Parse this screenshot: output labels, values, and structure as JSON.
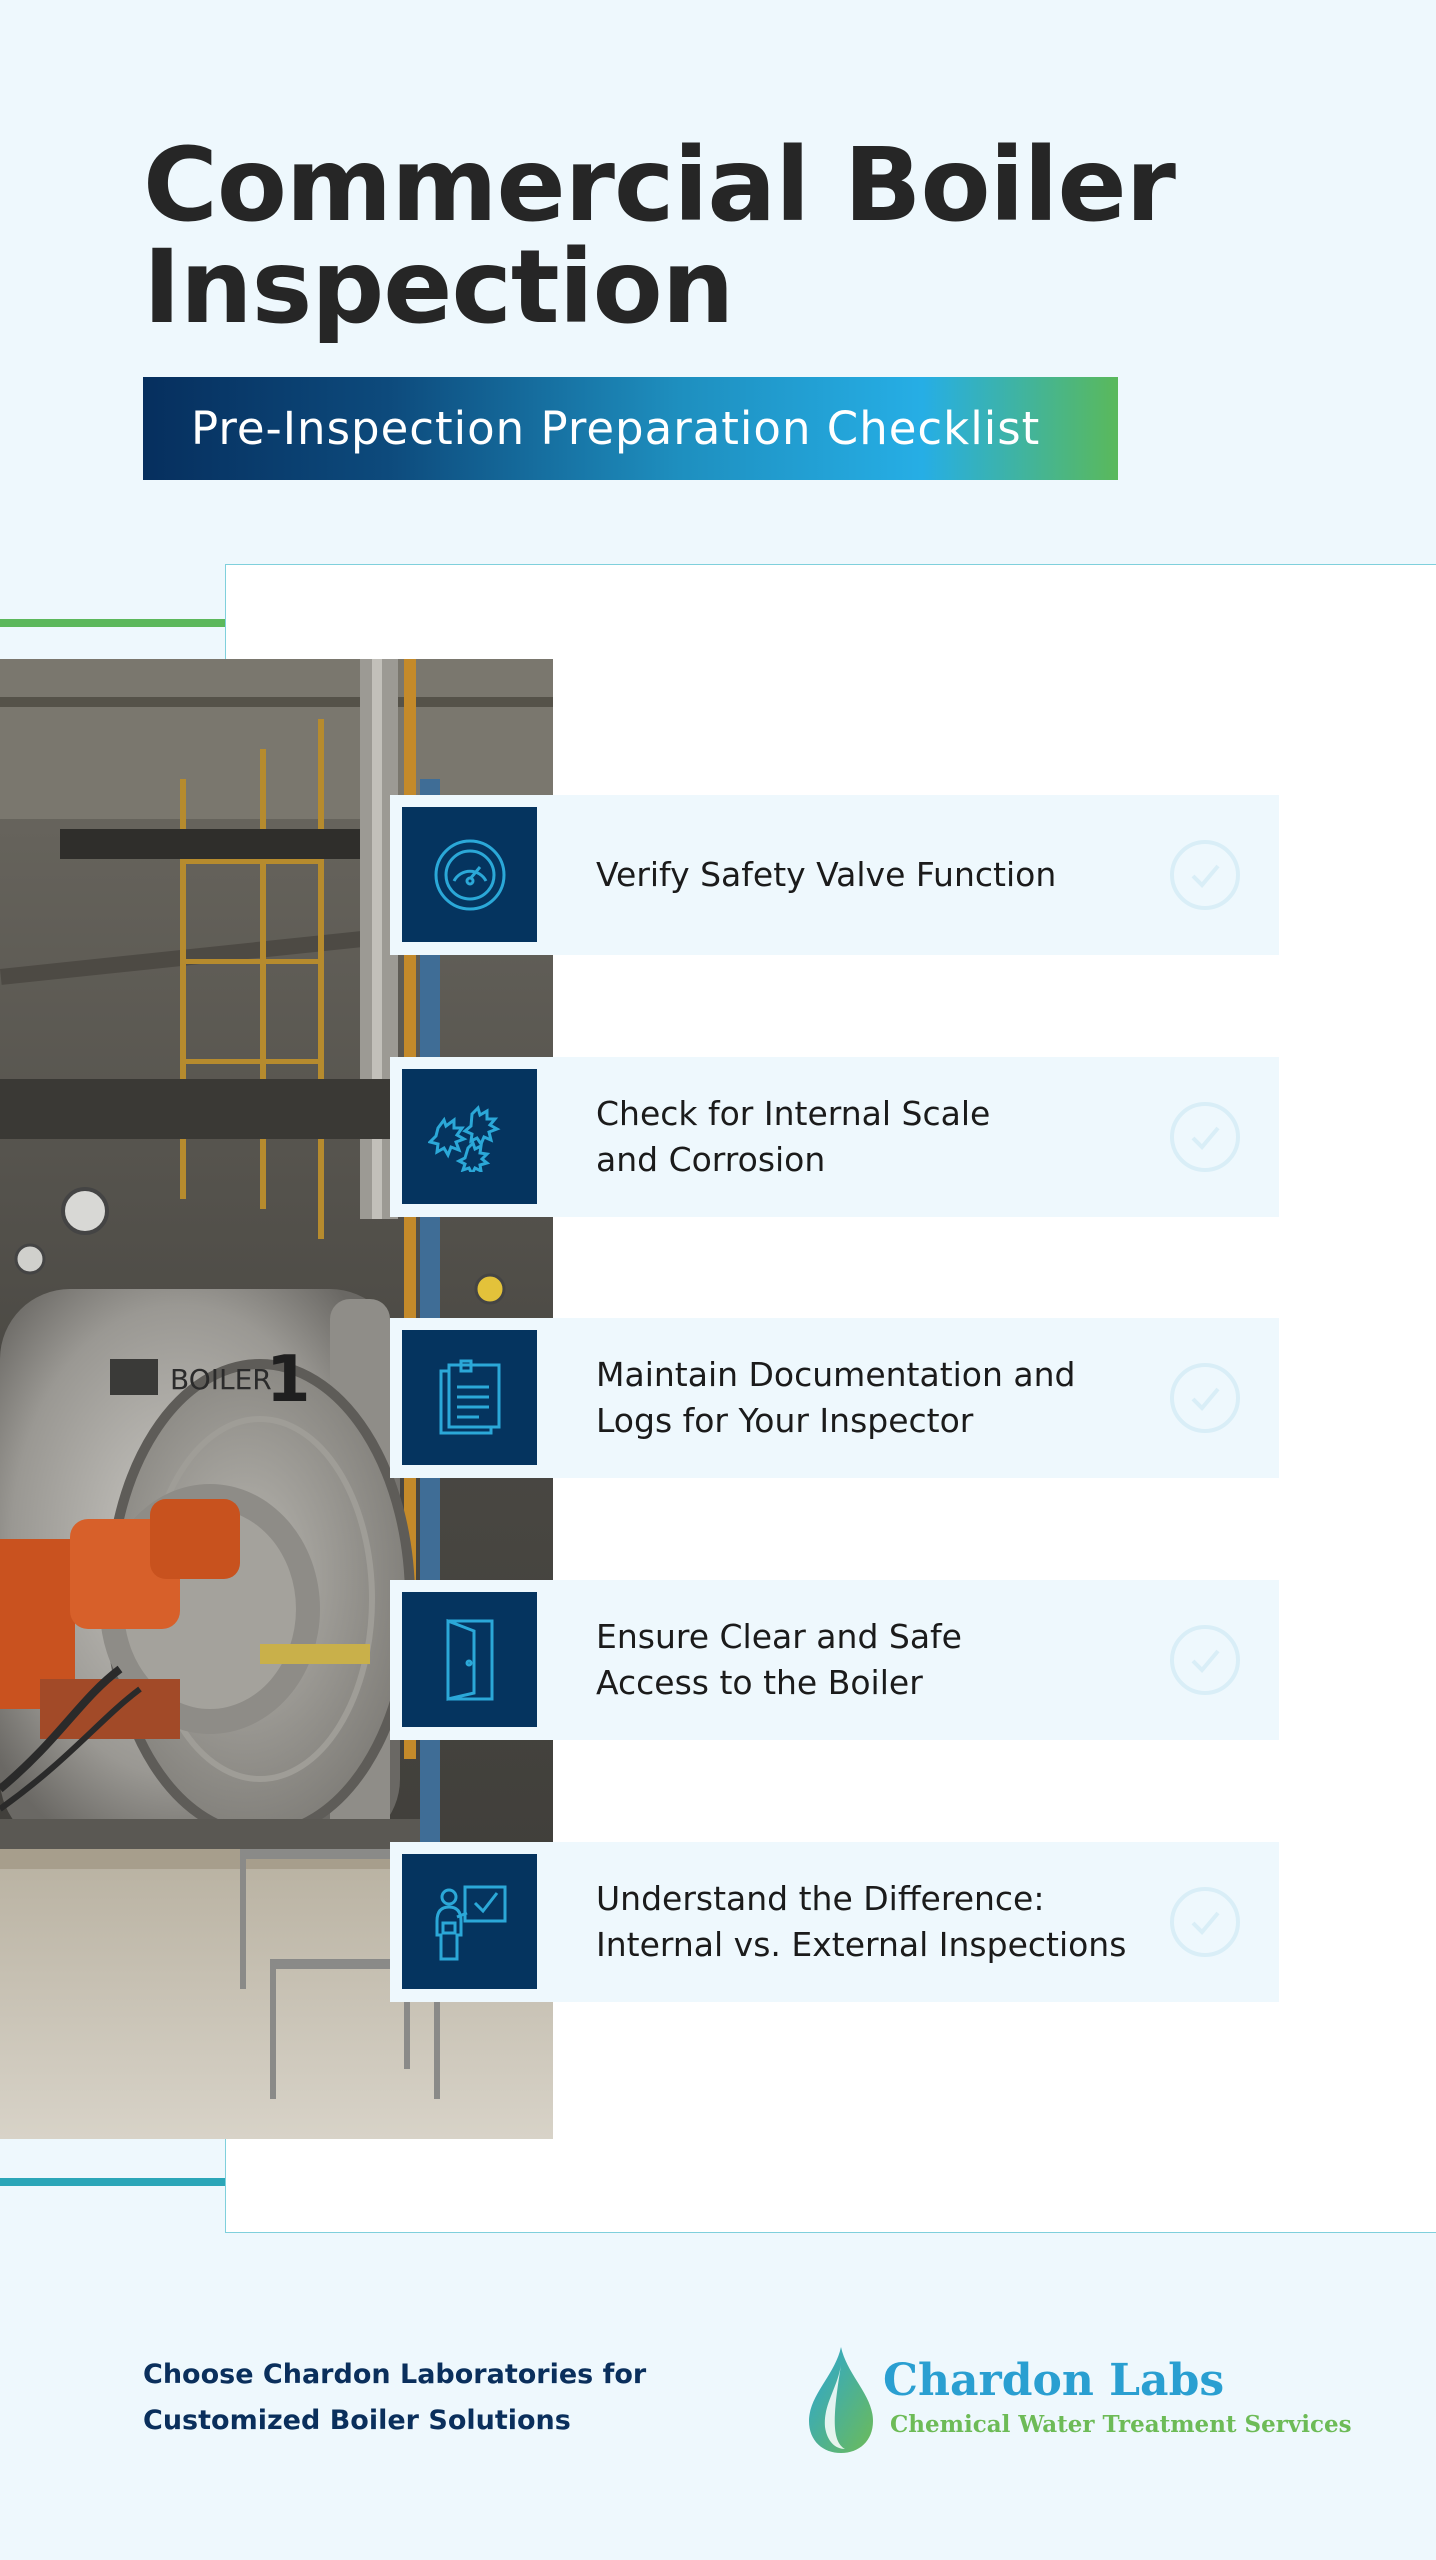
{
  "header": {
    "title": "Commercial Boiler Inspection",
    "subtitle": "Pre-Inspection Preparation Checklist"
  },
  "colors": {
    "navy": "#05345f",
    "icon_stroke": "#2ba8d8",
    "accent_green": "#5cb85c",
    "accent_teal": "#2ba6b8",
    "item_bg": "#eef8fd"
  },
  "photo": {
    "boiler_label": "BOILER",
    "boiler_number": "1"
  },
  "checklist": [
    {
      "icon": "gauge-icon",
      "label": "Verify Safety Valve Function"
    },
    {
      "icon": "scale-corrosion-icon",
      "label": "Check for Internal Scale\nand Corrosion"
    },
    {
      "icon": "clipboard-document-icon",
      "label": "Maintain Documentation and\nLogs for Your Inspector"
    },
    {
      "icon": "open-door-icon",
      "label": "Ensure Clear and Safe\nAccess to the Boiler"
    },
    {
      "icon": "presenter-board-icon",
      "label": "Understand the Difference:\nInternal vs. External Inspections"
    }
  ],
  "footer": {
    "text": "Choose Chardon Laboratories for\nCustomized Boiler Solutions",
    "logo_name": "Chardon Labs",
    "logo_tagline": "Chemical Water Treatment Services"
  }
}
